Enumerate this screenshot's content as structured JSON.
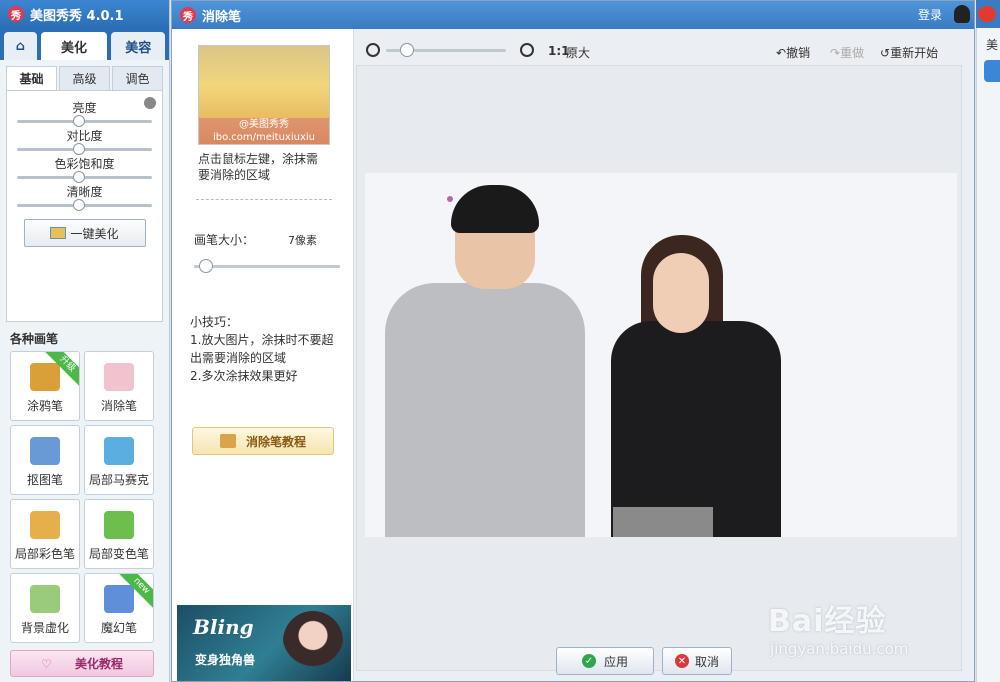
{
  "app": {
    "title": "美图秀秀 4.0.1",
    "logo_text": "秀",
    "login": "登录",
    "main_tabs": [
      "美化",
      "美容"
    ],
    "sub_tabs": [
      "基础",
      "高级",
      "调色"
    ],
    "sliders": [
      {
        "label": "亮度"
      },
      {
        "label": "对比度"
      },
      {
        "label": "色彩饱和度"
      },
      {
        "label": "清晰度"
      }
    ],
    "auto_beautify": "一键美化",
    "brushes_title": "各种画笔",
    "tools": [
      {
        "label": "涂鸦笔",
        "badge": "升级"
      },
      {
        "label": "消除笔",
        "badge": ""
      },
      {
        "label": "抠图笔",
        "badge": ""
      },
      {
        "label": "局部马赛克",
        "badge": ""
      },
      {
        "label": "局部彩色笔",
        "badge": ""
      },
      {
        "label": "局部变色笔",
        "badge": ""
      },
      {
        "label": "背景虚化",
        "badge": ""
      },
      {
        "label": "魔幻笔",
        "badge": "new"
      }
    ],
    "beautify_tutorial": "美化教程",
    "right_label": "美"
  },
  "dialog": {
    "title": "消除笔",
    "logo_text": "秀",
    "thumbnail_watermark": [
      "@美图秀秀",
      "ibo.com/meituxiuxiu"
    ],
    "hint": "点击鼠标左键，涂抹需要消除的区域",
    "brush_size_label": "画笔大小：",
    "brush_size_value": "7像素",
    "brush_size_fraction": 0.05,
    "tips_title": "小技巧：",
    "tips": [
      "1.放大图片，涂抹时不要超出需要消除的区域",
      "2.多次涂抹效果更好"
    ],
    "eraser_tutorial": "消除笔教程",
    "ad": {
      "title": "Bling",
      "subtitle": "变身独角兽"
    },
    "toolbar": {
      "ratio": "1:1",
      "original_size": "原大",
      "undo": "撤销",
      "redo": "重做",
      "restart": "重新开始"
    },
    "apply": "应用",
    "cancel": "取消"
  },
  "watermark": {
    "logo": "Bai经验",
    "url": "jingyan.baidu.com"
  },
  "colors": {
    "title_bar": "#2a6fb6",
    "apply_icon": "#2ea84a",
    "cancel_icon": "#d83a3a"
  }
}
